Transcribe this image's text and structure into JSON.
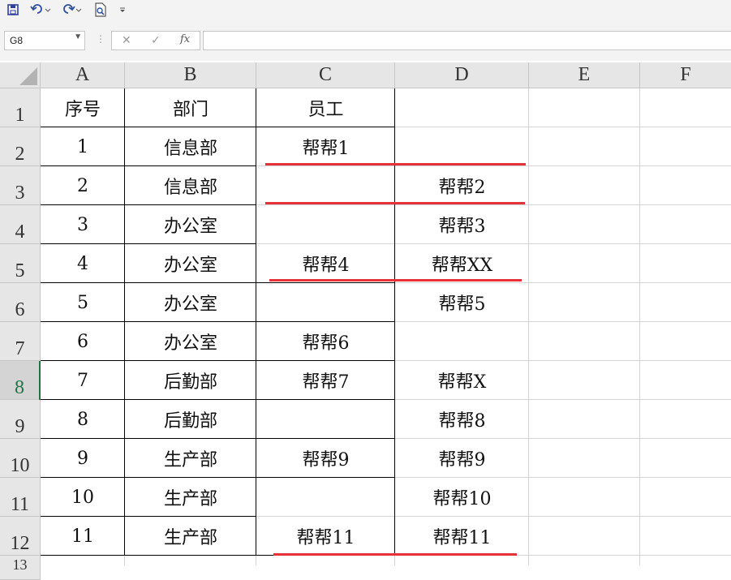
{
  "toolbar": {
    "icons": [
      "save-icon",
      "undo-icon",
      "redo-icon",
      "print-preview-icon",
      "customize-icon"
    ]
  },
  "formula_bar": {
    "name_box": "G8",
    "cancel_symbol": "✕",
    "enter_symbol": "✓",
    "fx_symbol": "fx",
    "content": ""
  },
  "columns": [
    "A",
    "B",
    "C",
    "D",
    "E",
    "F"
  ],
  "rows": [
    "1",
    "2",
    "3",
    "4",
    "5",
    "6",
    "7",
    "8",
    "9",
    "10",
    "11",
    "12"
  ],
  "row13_partial": "13",
  "selected_row": "8",
  "table": {
    "headers": [
      "序号",
      "部门",
      "员工",
      ""
    ],
    "rows": [
      [
        "1",
        "信息部",
        "帮帮1",
        ""
      ],
      [
        "2",
        "信息部",
        "",
        "帮帮2"
      ],
      [
        "3",
        "办公室",
        "",
        "帮帮3"
      ],
      [
        "4",
        "办公室",
        "帮帮4",
        "帮帮XX"
      ],
      [
        "5",
        "办公室",
        "",
        "帮帮5"
      ],
      [
        "6",
        "办公室",
        "帮帮6",
        ""
      ],
      [
        "7",
        "后勤部",
        "帮帮7",
        "帮帮X"
      ],
      [
        "8",
        "后勤部",
        "",
        "帮帮8"
      ],
      [
        "9",
        "生产部",
        "帮帮9",
        "帮帮9"
      ],
      [
        "10",
        "生产部",
        "",
        "帮帮10"
      ],
      [
        "11",
        "生产部",
        "帮帮11",
        "帮帮11"
      ]
    ]
  },
  "annotation_color": "#e8323a"
}
